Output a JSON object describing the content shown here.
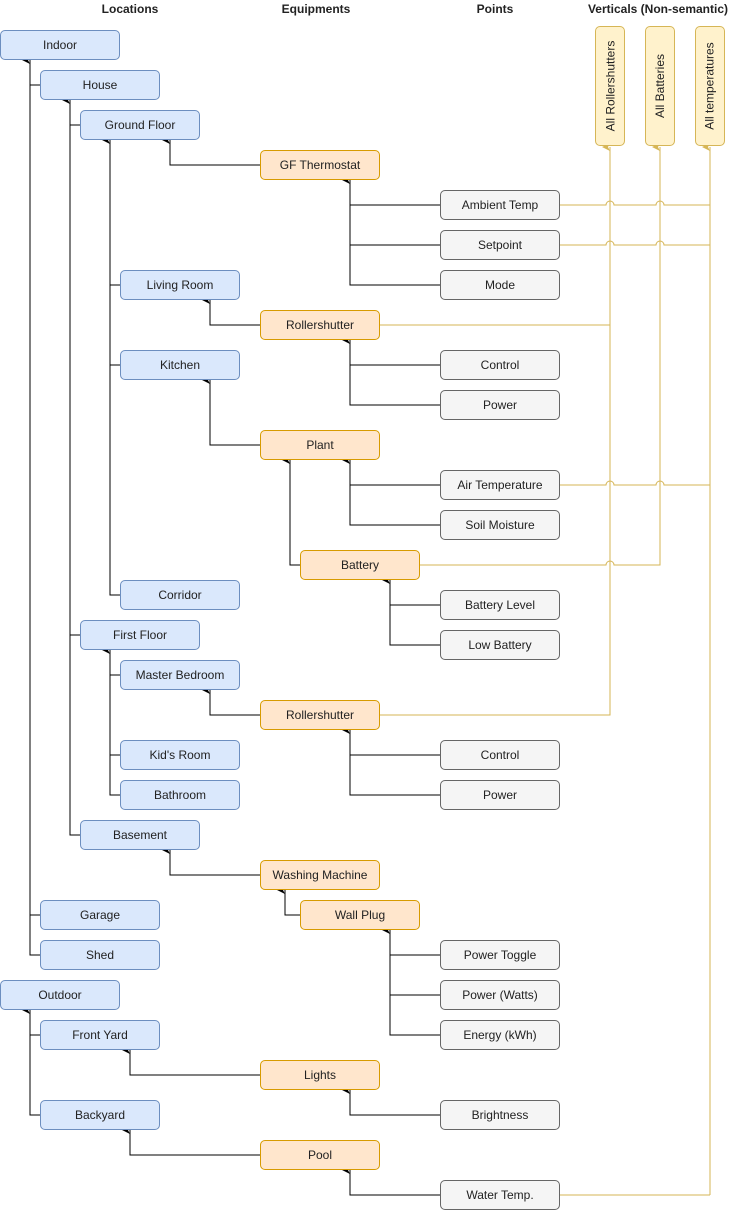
{
  "headers": {
    "locations": "Locations",
    "equipments": "Equipments",
    "points": "Points",
    "verticals": "Verticals (Non-semantic)"
  },
  "locations": {
    "indoor": "Indoor",
    "house": "House",
    "ground_floor": "Ground Floor",
    "living_room": "Living Room",
    "kitchen": "Kitchen",
    "corridor": "Corridor",
    "first_floor": "First Floor",
    "master_bedroom": "Master Bedroom",
    "kids_room": "Kid's Room",
    "bathroom": "Bathroom",
    "basement": "Basement",
    "garage": "Garage",
    "shed": "Shed",
    "outdoor": "Outdoor",
    "front_yard": "Front Yard",
    "backyard": "Backyard"
  },
  "equipments": {
    "gf_thermostat": "GF Thermostat",
    "rollershutter_lr": "Rollershutter",
    "plant": "Plant",
    "battery": "Battery",
    "rollershutter_mb": "Rollershutter",
    "washing_machine": "Washing Machine",
    "wall_plug": "Wall Plug",
    "lights": "Lights",
    "pool": "Pool"
  },
  "points": {
    "ambient_temp": "Ambient Temp",
    "setpoint": "Setpoint",
    "mode": "Mode",
    "control_lr": "Control",
    "power_lr": "Power",
    "air_temperature": "Air Temperature",
    "soil_moisture": "Soil Moisture",
    "battery_level": "Battery Level",
    "low_battery": "Low Battery",
    "control_mb": "Control",
    "power_mb": "Power",
    "power_toggle": "Power Toggle",
    "power_watts": "Power (Watts)",
    "energy_kwh": "Energy (kWh)",
    "brightness": "Brightness",
    "water_temp": "Water Temp."
  },
  "verticals": {
    "all_rollershutters": "All Rollershutters",
    "all_batteries": "All Batteries",
    "all_temperatures": "All temperatures"
  },
  "colors": {
    "location_fill": "#dae8fc",
    "location_stroke": "#6c8ebf",
    "equipment_fill": "#ffe6cc",
    "equipment_stroke": "#d79b00",
    "point_fill": "#f5f5f5",
    "point_stroke": "#666666",
    "vertical_fill": "#fff2cc",
    "vertical_stroke": "#d6b656",
    "edge": "#000000",
    "vertical_edge": "#d6b656"
  }
}
